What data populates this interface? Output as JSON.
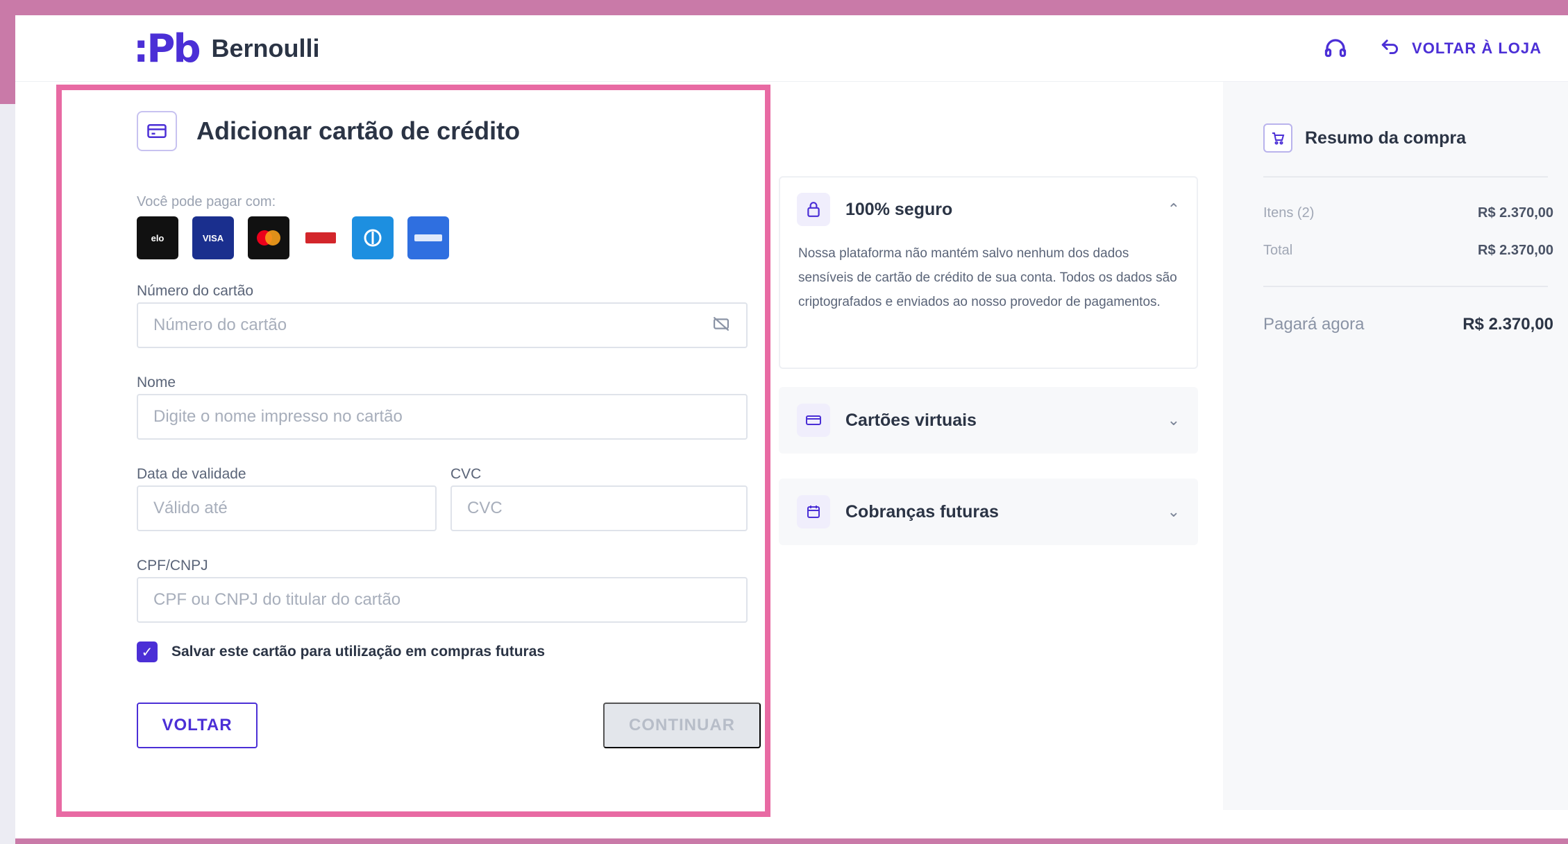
{
  "header": {
    "logo_mark": ":Pb",
    "brand_name": "Bernoulli",
    "back_to_store": "VOLTAR À LOJA"
  },
  "form": {
    "title": "Adicionar cartão de crédito",
    "pay_with_label": "Você pode pagar com:",
    "brands": [
      "elo",
      "VISA",
      "mastercard",
      "hipercard",
      "diners",
      "amex"
    ],
    "card_number": {
      "label": "Número do cartão",
      "placeholder": "Número do cartão",
      "value": ""
    },
    "name": {
      "label": "Nome",
      "placeholder": "Digite o nome impresso no cartão",
      "value": ""
    },
    "expiry": {
      "label": "Data de validade",
      "placeholder": "Válido até",
      "value": ""
    },
    "cvc": {
      "label": "CVC",
      "placeholder": "CVC",
      "value": ""
    },
    "cpf": {
      "label": "CPF/CNPJ",
      "placeholder": "CPF ou CNPJ do titular do cartão",
      "value": ""
    },
    "save_card_label": "Salvar este cartão para utilização em compras futuras",
    "save_card_checked": true,
    "back_button": "VOLTAR",
    "continue_button": "CONTINUAR"
  },
  "info": {
    "secure": {
      "title": "100% seguro",
      "body": "Nossa plataforma não mantém salvo nenhum dos dados sensíveis de cartão de crédito de sua conta. Todos os dados são criptografados e enviados ao nosso provedor de pagamentos.",
      "expanded": true
    },
    "virtual_cards": {
      "title": "Cartões virtuais",
      "expanded": false
    },
    "future_charges": {
      "title": "Cobranças futuras",
      "expanded": false
    }
  },
  "summary": {
    "title": "Resumo da compra",
    "items_label": "Itens (2)",
    "items_value": "R$ 2.370,00",
    "total_label": "Total",
    "total_value": "R$ 2.370,00",
    "pay_now_label": "Pagará agora",
    "pay_now_value": "R$ 2.370,00"
  },
  "colors": {
    "accent": "#4b2fd6",
    "highlight_border": "#e86aa3",
    "frame": "#c97aa8"
  }
}
